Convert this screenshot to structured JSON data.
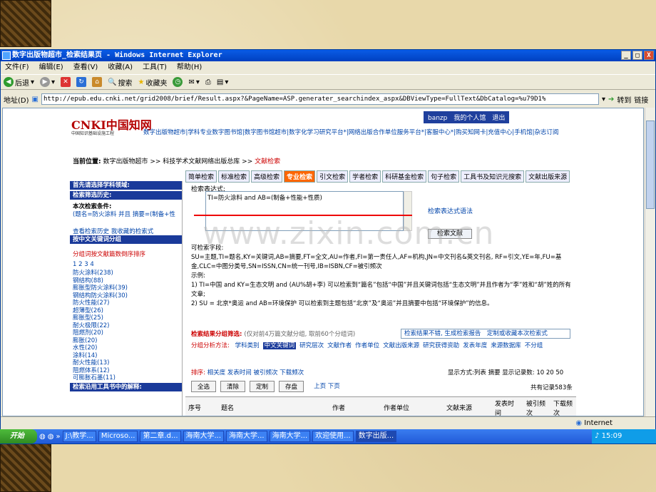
{
  "window": {
    "title": "数字出版物超市_检索结果页 - Windows Internet Explorer",
    "buttons": [
      "_",
      "□",
      "X"
    ]
  },
  "menu": [
    "文件(F)",
    "编辑(E)",
    "查看(V)",
    "收藏(A)",
    "工具(T)",
    "帮助(H)"
  ],
  "toolbar": {
    "back": "后退",
    "search": "搜索",
    "favorites": "收藏夹"
  },
  "address": {
    "label": "地址(D)",
    "url": "http://epub.edu.cnki.net/grid2008/brief/Result.aspx?&PageName=ASP.generater_searchindex_aspx&DBViewType=FullText&DbCatalog=%u79D1%",
    "go": "转到",
    "links": "链接"
  },
  "page": {
    "logo": "CNKI中国知网",
    "logo_url": "www.cnki.net",
    "logo_sub": "中国知识基础设施工程",
    "top_links": "banzp　我的个人馆　退出",
    "nav": "数字出版物超市|学科专业数字图书馆|数字图书馆超市|数字化学习研究平台*|网络出版合作单位服务平台*|客服中心*|购买知网卡|充值中心|手机馆|杂志订阅",
    "location_label": "当前位置:",
    "location": "数字出版物超市 >> 科技学术文献网络出版总库 >> ",
    "location_current": "文献检索",
    "tabs": [
      "简单检索",
      "标准检索",
      "高级检索",
      "专业检索",
      "引文检索",
      "学者检索",
      "科研基金检索",
      "句子检索",
      "工具书及知识元搜索",
      "文献出版来源"
    ],
    "left": {
      "subject_header": "首先请选择学科领域:",
      "filter_header": "检索筛选历史:",
      "cond_title": "本次检索条件:",
      "cond_value": "(题名=防火涂料 并且 摘要=(制备+性",
      "history": "查看检索历史",
      "my_search": "我收藏的检索式",
      "group_header": "按中文关键词分组",
      "sort_tip": "分组词按文献篇数倒序排序",
      "pages": "1 2 3 4",
      "keywords": [
        "防火涂料(238)",
        "钢结构(88)",
        "膨胀型防火涂料(39)",
        "钢结构防火涂料(30)",
        "防火性能(27)",
        "超薄型(26)",
        "膨胀型(25)",
        "耐火极限(22)",
        "阻燃剂(20)",
        "膨胀(20)",
        "水性(20)",
        "涂料(14)",
        "耐火性能(13)",
        "阻燃体系(12)",
        "可膨胀石墨(11)"
      ],
      "bottom_header": "检索沿用工具书中的解释:"
    },
    "expr_label": "检索表达式:",
    "expr_value": "TI=防火涂料 and AB=(制备+性能+性质)",
    "grammar": "检索表达式语法",
    "search_button": "检索文献",
    "fields_title": "可检索字段:",
    "fields_text": "SU=主题,TI=题名,KY=关键词,AB=摘要,FT=全文,AU=作者,FI=第一责任人,AF=机构,JN=中文刊名&英文刊名, RF=引文,YE=年,FU=基金,CLC=中图分类号,SN=ISSN,CN=统一刊号,IB=ISBN,CF=被引频次",
    "example_title": "示例:",
    "example1": "1) TI=中国 and KY=生态文明 and (AU%胡+李) 可以检索到“篇名”包括“中国”并且关键词包括“生态文明”并且作者为“李”姓和“胡”姓的所有文章;",
    "example2": "2) SU = 北京*奥运 and AB=环境保护 可以检索到主题包括“北京”及“奥运”并且摘要中包括“环境保护”的信息。",
    "filter_label": "检索结果分组筛选:",
    "filter_note": "(仅对前4万篇文献分组, 取前60个分组词)",
    "filter_links": "检索结果不错, 生成检索报告　定制或收藏本次检索式",
    "group_label": "分组分析方法:",
    "group_items": [
      "学科类别",
      "中文关键词",
      "研究层次",
      "文献作者",
      "作者单位",
      "文献出版来源",
      "研究获得资助",
      "发表年度",
      "来源数据库",
      "不分组"
    ],
    "sort_label": "排序:",
    "sort_items": "相关度 发表时间 被引频次 下载频次",
    "display": "显示方式:列表 摘要 显示记录数: 10 20 50",
    "buttons": [
      "全选",
      "清除",
      "定制",
      "存盘"
    ],
    "pager": "上页 下页",
    "total": "共有记录583条",
    "columns": [
      "序号",
      "题名",
      "作者",
      "作者单位",
      "文献来源",
      "发表时间",
      "被引频次",
      "下载频次"
    ],
    "watermark": "www.zixin.com.cn"
  },
  "status": {
    "zone": "Internet"
  },
  "taskbar": {
    "start": "开始",
    "items": [
      "J:\\教学...",
      "Microso...",
      "第二章.d...",
      "海南大学...",
      "海南大学...",
      "海南大学...",
      "欢迎使用...",
      "数字出版..."
    ],
    "clock": "15:09"
  },
  "colors": {
    "accent": "#1a3a9a",
    "highlight": "#ff6600",
    "link": "#0044aa",
    "title": "#0a5ce6"
  }
}
